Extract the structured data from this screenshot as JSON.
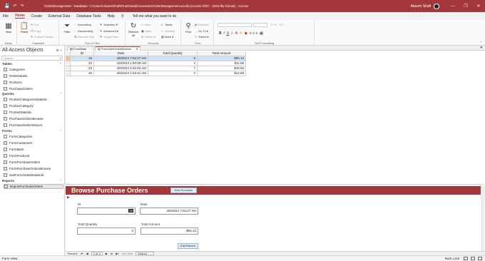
{
  "titlebar": {
    "title": "OrderManagement : Database- C:\\Users\\AkeemShafi\\OneDrive\\Documents\\OrderManagement.accdb (Access 2007 - 2016 file format) - Access",
    "user": "Akeem Shafi",
    "qat_icons": [
      "save-icon",
      "undo-icon",
      "redo-icon"
    ],
    "window_controls": [
      "minimize",
      "restore",
      "close"
    ]
  },
  "menu": {
    "items": [
      "File",
      "Home",
      "Create",
      "External Data",
      "Database Tools",
      "Help"
    ],
    "active": "Home",
    "tellme": "Tell me what you want to do"
  },
  "ribbon": {
    "views": {
      "label": "Views",
      "view": "View"
    },
    "clipboard": {
      "label": "Clipboard",
      "paste": "Paste",
      "cut": "Cut",
      "copy": "Copy",
      "format_painter": "Format Painter"
    },
    "sort_filter": {
      "label": "Sort & Filter",
      "filter": "Filter",
      "ascending": "Ascending",
      "descending": "Descending",
      "remove_sort": "Remove Sort",
      "selection": "Selection",
      "advanced": "Advanced",
      "toggle_filter": "Toggle Filter"
    },
    "records": {
      "label": "Records",
      "refresh": "Refresh All",
      "new": "New",
      "save": "Save",
      "delete": "Delete",
      "totals": "Totals",
      "spelling": "Spelling",
      "more": "More"
    },
    "find": {
      "label": "Find",
      "find": "Find",
      "replace": "Replace",
      "goto": "Go To",
      "select": "Select"
    },
    "text_formatting": {
      "label": "Text Formatting"
    }
  },
  "nav": {
    "title": "All Access Objects",
    "search_placeholder": "Search...",
    "categories": [
      {
        "name": "Tables",
        "items": [
          "Categories",
          "OrderDetails",
          "Products",
          "PurchaseOrders"
        ]
      },
      {
        "name": "Queries",
        "items": [
          "ProductCategoriesStatistic",
          "ProductCategory",
          "ProductStatistic",
          "PurchaseOrdersBrowse",
          "PurchaseOrdersReport"
        ]
      },
      {
        "name": "Forms",
        "items": [
          "FormCategories",
          "FormCustomers",
          "FormMain",
          "FormProducts",
          "FormPurchaseOrders",
          "FormPurchaseOrdersBrowse",
          "SubFormOrderDetailList"
        ]
      },
      {
        "name": "Reports",
        "items": [
          "ReportPurchaseOrders"
        ]
      }
    ]
  },
  "tabs": [
    "FormMain",
    "PurchaseOrdersBrowse"
  ],
  "grid": {
    "columns": [
      "ID",
      "Date",
      "Total Quantity",
      "Total Amount"
    ],
    "rows": [
      [
        "16",
        "4/6/2024 7:52:27 AM",
        "6",
        "$55.13"
      ],
      [
        "22",
        "4/6/2024 1:50:08 AM",
        "2",
        "$11.68"
      ],
      [
        "23",
        "4/6/2024 1:51:02 AM",
        "7",
        "$45.93"
      ],
      [
        "26",
        "4/6/2024 1:53:31 AM",
        "2",
        "$14.68"
      ]
    ]
  },
  "form": {
    "title": "Browse Purchase Orders",
    "new_button": "New Purchase",
    "edit_button": "Edit Record",
    "id_label": "ID",
    "id_value": "16",
    "date_label": "Date",
    "date_value": "4/6/2024 7:52:27 AM",
    "qty_label": "Total Quantity",
    "qty_value": "6",
    "amount_label": "Total Amount",
    "amount_value": "$55.13"
  },
  "recnav": {
    "record_label": "Record:",
    "position": "1 of 4",
    "filter": "No Filter",
    "search": "Search"
  },
  "status": {
    "left": "Form View",
    "right": "Num Lock"
  }
}
